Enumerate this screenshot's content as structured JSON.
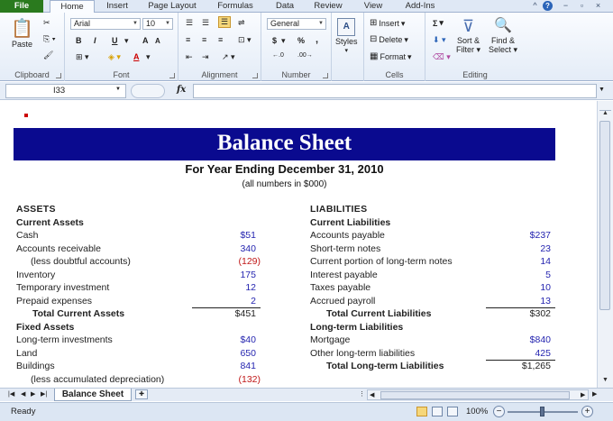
{
  "ribbon_tabs": [
    "File",
    "Home",
    "Insert",
    "Page Layout",
    "Formulas",
    "Data",
    "Review",
    "View",
    "Add-Ins"
  ],
  "ribbon": {
    "clipboard": {
      "paste": "Paste",
      "label": "Clipboard"
    },
    "font": {
      "name": "Arial",
      "size": "10",
      "bold": "B",
      "italic": "I",
      "underline": "U",
      "grow": "A",
      "shrink": "A",
      "color_letter": "A",
      "label": "Font"
    },
    "alignment": {
      "label": "Alignment"
    },
    "number": {
      "format": "General",
      "currency": "$",
      "percent": "%",
      "comma": ",",
      "label": "Number"
    },
    "styles": {
      "styles": "Styles",
      "label": ""
    },
    "cells": {
      "insert": "Insert",
      "delete": "Delete",
      "format": "Format",
      "label": "Cells"
    },
    "editing": {
      "sum": "Σ",
      "sort_filter_1": "Sort &",
      "sort_filter_2": "Filter",
      "find_select_1": "Find &",
      "find_select_2": "Select",
      "label": "Editing"
    }
  },
  "formula_bar": {
    "name_box": "I33",
    "fx": "fx",
    "formula": ""
  },
  "sheet": {
    "title": "Balance Sheet",
    "subtitle": "For Year Ending December 31, 2010",
    "note": "(all numbers in $000)",
    "assets": {
      "header": "ASSETS",
      "current_header": "Current Assets",
      "current": [
        {
          "label": "Cash",
          "value": "$51"
        },
        {
          "label": "Accounts receivable",
          "value": "340"
        },
        {
          "label": "(less doubtful accounts)",
          "value": "(129)"
        },
        {
          "label": "Inventory",
          "value": "175"
        },
        {
          "label": "Temporary investment",
          "value": "12"
        },
        {
          "label": "Prepaid expenses",
          "value": "2"
        }
      ],
      "total_current_label": "Total Current Assets",
      "total_current_value": "$451",
      "fixed_header": "Fixed Assets",
      "fixed": [
        {
          "label": "Long-term investments",
          "value": "$40"
        },
        {
          "label": "Land",
          "value": "650"
        },
        {
          "label": "Buildings",
          "value": "841"
        },
        {
          "label": "(less accumulated depreciation)",
          "value": "(132)"
        }
      ]
    },
    "liabilities": {
      "header": "LIABILITIES",
      "current_header": "Current Liabilities",
      "current": [
        {
          "label": "Accounts payable",
          "value": "$237"
        },
        {
          "label": "Short-term notes",
          "value": "23"
        },
        {
          "label": "Current portion of long-term notes",
          "value": "14"
        },
        {
          "label": "Interest payable",
          "value": "5"
        },
        {
          "label": "Taxes payable",
          "value": "10"
        },
        {
          "label": "Accrued payroll",
          "value": "13"
        }
      ],
      "total_current_label": "Total Current Liabilities",
      "total_current_value": "$302",
      "longterm_header": "Long-term Liabilities",
      "longterm": [
        {
          "label": "Mortgage",
          "value": "$840"
        },
        {
          "label": "Other long-term liabilities",
          "value": "425"
        }
      ],
      "total_longterm_label": "Total Long-term Liabilities",
      "total_longterm_value": "$1,265"
    }
  },
  "sheet_tab": "Balance Sheet",
  "status": {
    "ready": "Ready",
    "zoom": "100%"
  },
  "colors": {
    "title_banner": "#0a0a8f",
    "value_blue": "#2525b0",
    "negative_red": "#c01818",
    "file_tab": "#2a7a1e"
  }
}
